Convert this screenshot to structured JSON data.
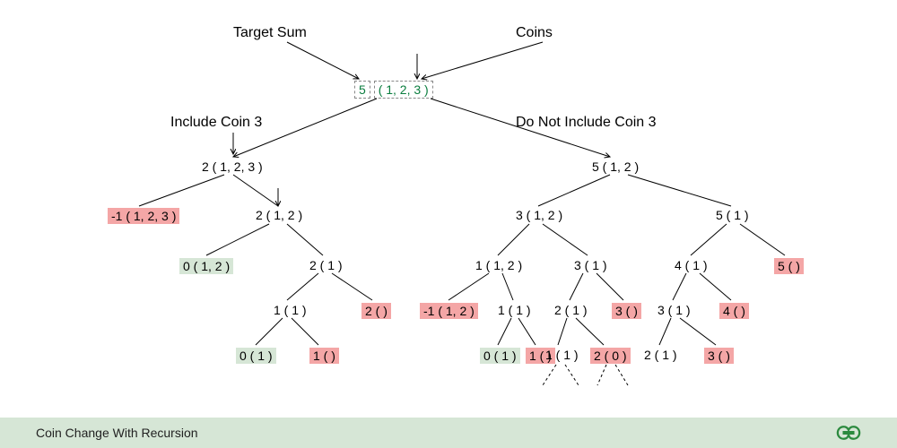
{
  "labels": {
    "target_sum": "Target Sum",
    "coins": "Coins",
    "include": "Include Coin 3",
    "exclude": "Do Not Include Coin 3"
  },
  "root": {
    "sum": "5",
    "coins": "( 1, 2, 3 )"
  },
  "nodes": {
    "n2_123": "2 ( 1, 2, 3 )",
    "n5_12": "5 ( 1, 2 )",
    "nm1_123": "-1 ( 1, 2, 3 )",
    "n2_12": "2 ( 1, 2 )",
    "n3_12": "3 ( 1, 2 )",
    "n5_1": "5 ( 1 )",
    "n0_12": "0 ( 1, 2 )",
    "n2_1": "2 ( 1 )",
    "n1_12": "1 ( 1, 2 )",
    "n3_1": "3 ( 1 )",
    "n4_1": "4 ( 1 )",
    "n5_": "5 ( )",
    "n1_1": "1 ( 1 )",
    "n2_": "2 ( )",
    "nm1_12": "-1 ( 1, 2 )",
    "n1_1b": "1 ( 1 )",
    "n2_1b": "2 ( 1 )",
    "n3_": "3 ( )",
    "n3_1b": "3 ( 1 )",
    "n4_": "4 ( )",
    "n0_1": "0 ( 1 )",
    "n1_": "1 ( )",
    "n0_1b": "0 ( 1 )",
    "n1_b": "1 ( )",
    "n1_1c": "1 ( 1 )",
    "n2_0": "2 ( 0 )",
    "n2_1c": "2 ( 1 )",
    "n3_b": "3 ( )"
  },
  "footer": {
    "title": "Coin Change With Recursion"
  }
}
